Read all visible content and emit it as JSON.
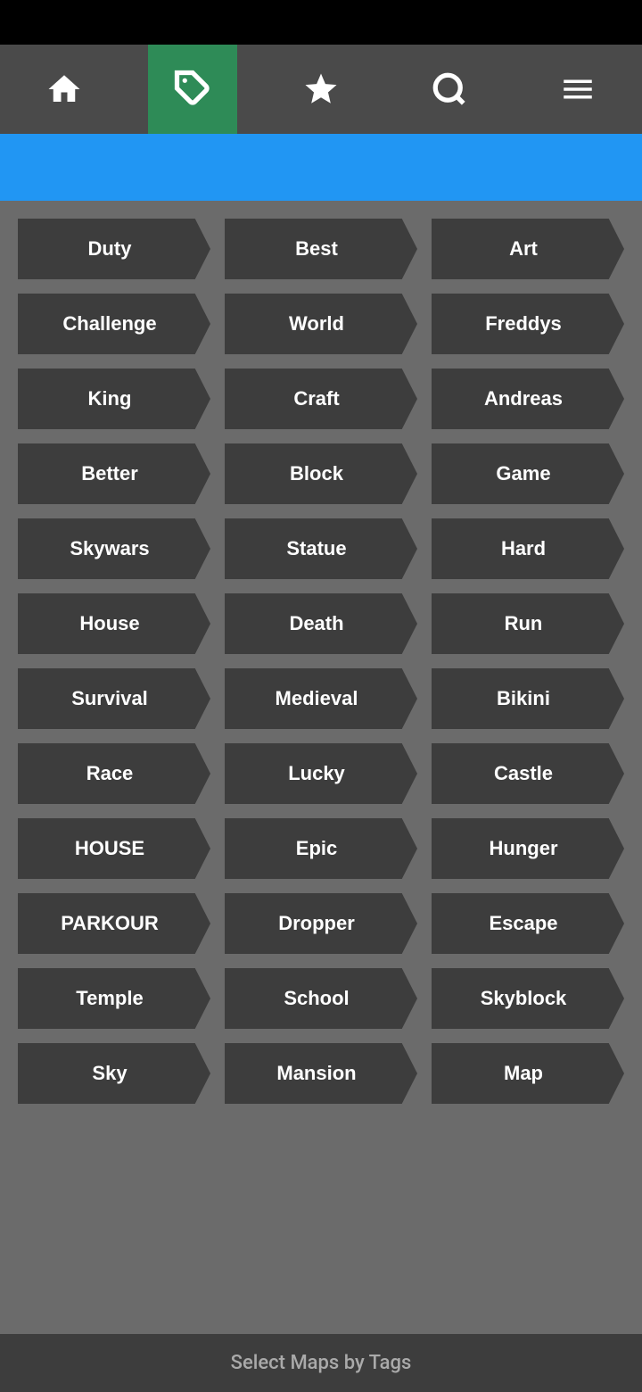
{
  "statusBar": {},
  "navBar": {
    "items": [
      {
        "id": "home",
        "icon": "home-icon",
        "active": false
      },
      {
        "id": "tags",
        "icon": "tag-icon",
        "active": true
      },
      {
        "id": "favorites",
        "icon": "star-icon",
        "active": false
      },
      {
        "id": "search",
        "icon": "search-icon",
        "active": false
      },
      {
        "id": "menu",
        "icon": "menu-icon",
        "active": false
      }
    ]
  },
  "headerStrip": {},
  "tags": {
    "title": "Select Maps by Tags",
    "items": [
      "Duty",
      "Best",
      "Art",
      "Challenge",
      "World",
      "Freddys",
      "King",
      "Craft",
      "Andreas",
      "Better",
      "Block",
      "Game",
      "Skywars",
      "Statue",
      "Hard",
      "House",
      "Death",
      "Run",
      "Survival",
      "Medieval",
      "Bikini",
      "Race",
      "Lucky",
      "Castle",
      "HOUSE",
      "Epic",
      "Hunger",
      "PARKOUR",
      "Dropper",
      "Escape",
      "Temple",
      "School",
      "Skyblock",
      "Sky",
      "Mansion",
      "Map"
    ]
  },
  "footer": {
    "label": "Select Maps by Tags"
  }
}
